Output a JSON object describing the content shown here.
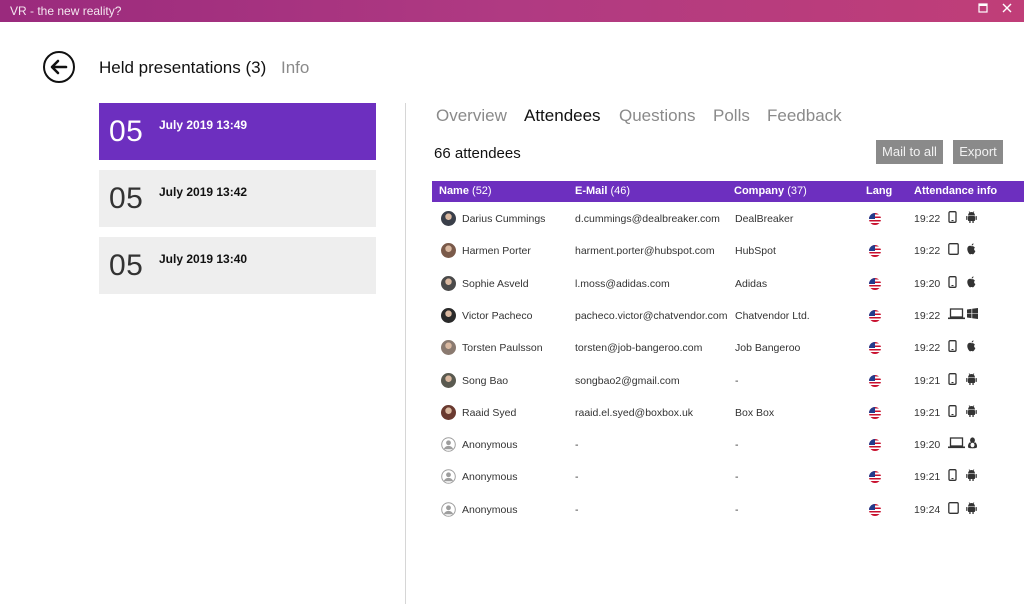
{
  "window": {
    "title": "VR - the new reality?",
    "restore_icon": "restore-icon",
    "close_icon": "close-icon"
  },
  "header": {
    "title": "Held presentations (3)",
    "info_link": "Info",
    "back_icon": "arrow-left-icon"
  },
  "presentations": [
    {
      "day": "05",
      "label": "July 2019 13:49",
      "active": true
    },
    {
      "day": "05",
      "label": "July 2019 13:42",
      "active": false
    },
    {
      "day": "05",
      "label": "July 2019 13:40",
      "active": false
    }
  ],
  "tabs": [
    {
      "label": "Overview",
      "active": false
    },
    {
      "label": "Attendees",
      "active": true
    },
    {
      "label": "Questions",
      "active": false
    },
    {
      "label": "Polls",
      "active": false
    },
    {
      "label": "Feedback",
      "active": false
    }
  ],
  "attendees_count": "66 attendees",
  "actions": {
    "mail_all": "Mail to all",
    "export": "Export"
  },
  "table": {
    "columns": {
      "name": "Name",
      "name_count": "(52)",
      "email": "E-Mail",
      "email_count": "(46)",
      "company": "Company",
      "company_count": "(37)",
      "lang": "Lang",
      "attendance": "Attendance info"
    },
    "rows": [
      {
        "name": "Darius Cummings",
        "email": "d.cummings@dealbreaker.com",
        "company": "DealBreaker",
        "lang": "us-flag-icon",
        "time": "19:22",
        "device": "phone-icon",
        "os": "android-icon",
        "avatar": "photo",
        "avatar_color": "#3a3f4a"
      },
      {
        "name": "Harmen Porter",
        "email": "harment.porter@hubspot.com",
        "company": "HubSpot",
        "lang": "us-flag-icon",
        "time": "19:22",
        "device": "tablet-icon",
        "os": "apple-icon",
        "avatar": "photo",
        "avatar_color": "#7a5a4a"
      },
      {
        "name": "Sophie Asveld",
        "email": "l.moss@adidas.com",
        "company": "Adidas",
        "lang": "us-flag-icon",
        "time": "19:20",
        "device": "phone-icon",
        "os": "apple-icon",
        "avatar": "photo",
        "avatar_color": "#4a4a4a"
      },
      {
        "name": "Victor Pacheco",
        "email": "pacheco.victor@chatvendor.com",
        "company": "Chatvendor Ltd.",
        "lang": "us-flag-icon",
        "time": "19:22",
        "device": "laptop-icon",
        "os": "windows-icon",
        "avatar": "photo",
        "avatar_color": "#2a2a2a"
      },
      {
        "name": "Torsten Paulsson",
        "email": "torsten@job-bangeroo.com",
        "company": "Job Bangeroo",
        "lang": "us-flag-icon",
        "time": "19:22",
        "device": "phone-icon",
        "os": "apple-icon",
        "avatar": "photo",
        "avatar_color": "#8a7a70"
      },
      {
        "name": "Song Bao",
        "email": "songbao2@gmail.com",
        "company": "-",
        "lang": "us-flag-icon",
        "time": "19:21",
        "device": "phone-icon",
        "os": "android-icon",
        "avatar": "photo",
        "avatar_color": "#5a5a50"
      },
      {
        "name": "Raaid Syed",
        "email": "raaid.el.syed@boxbox.uk",
        "company": "Box Box",
        "lang": "us-flag-icon",
        "time": "19:21",
        "device": "phone-icon",
        "os": "android-icon",
        "avatar": "photo",
        "avatar_color": "#6a3a30"
      },
      {
        "name": "Anonymous",
        "email": "-",
        "company": "-",
        "lang": "us-flag-icon",
        "time": "19:20",
        "device": "laptop-icon",
        "os": "linux-icon",
        "avatar": "anonymous",
        "avatar_color": "#bdbdbd"
      },
      {
        "name": "Anonymous",
        "email": "-",
        "company": "-",
        "lang": "us-flag-icon",
        "time": "19:21",
        "device": "phone-icon",
        "os": "android-icon",
        "avatar": "anonymous",
        "avatar_color": "#bdbdbd"
      },
      {
        "name": "Anonymous",
        "email": "-",
        "company": "-",
        "lang": "us-flag-icon",
        "time": "19:24",
        "device": "tablet-icon",
        "os": "android-icon",
        "avatar": "anonymous",
        "avatar_color": "#bdbdbd"
      }
    ]
  }
}
